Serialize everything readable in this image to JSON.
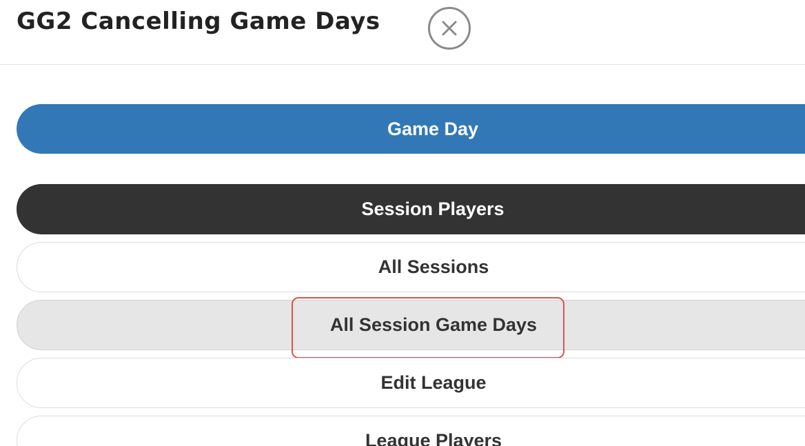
{
  "header": {
    "title": "GG2 Cancelling Game Days",
    "close_icon": "close-icon"
  },
  "menu": {
    "game_day": "Game Day",
    "session_players": "Session Players",
    "all_sessions": "All Sessions",
    "all_session_game_days": "All Session Game Days",
    "edit_league": "Edit League",
    "league_players": "League Players"
  },
  "colors": {
    "primary": "#3278b6",
    "dark": "#333333",
    "active": "#e6e6e6",
    "highlight": "#d9534f"
  }
}
